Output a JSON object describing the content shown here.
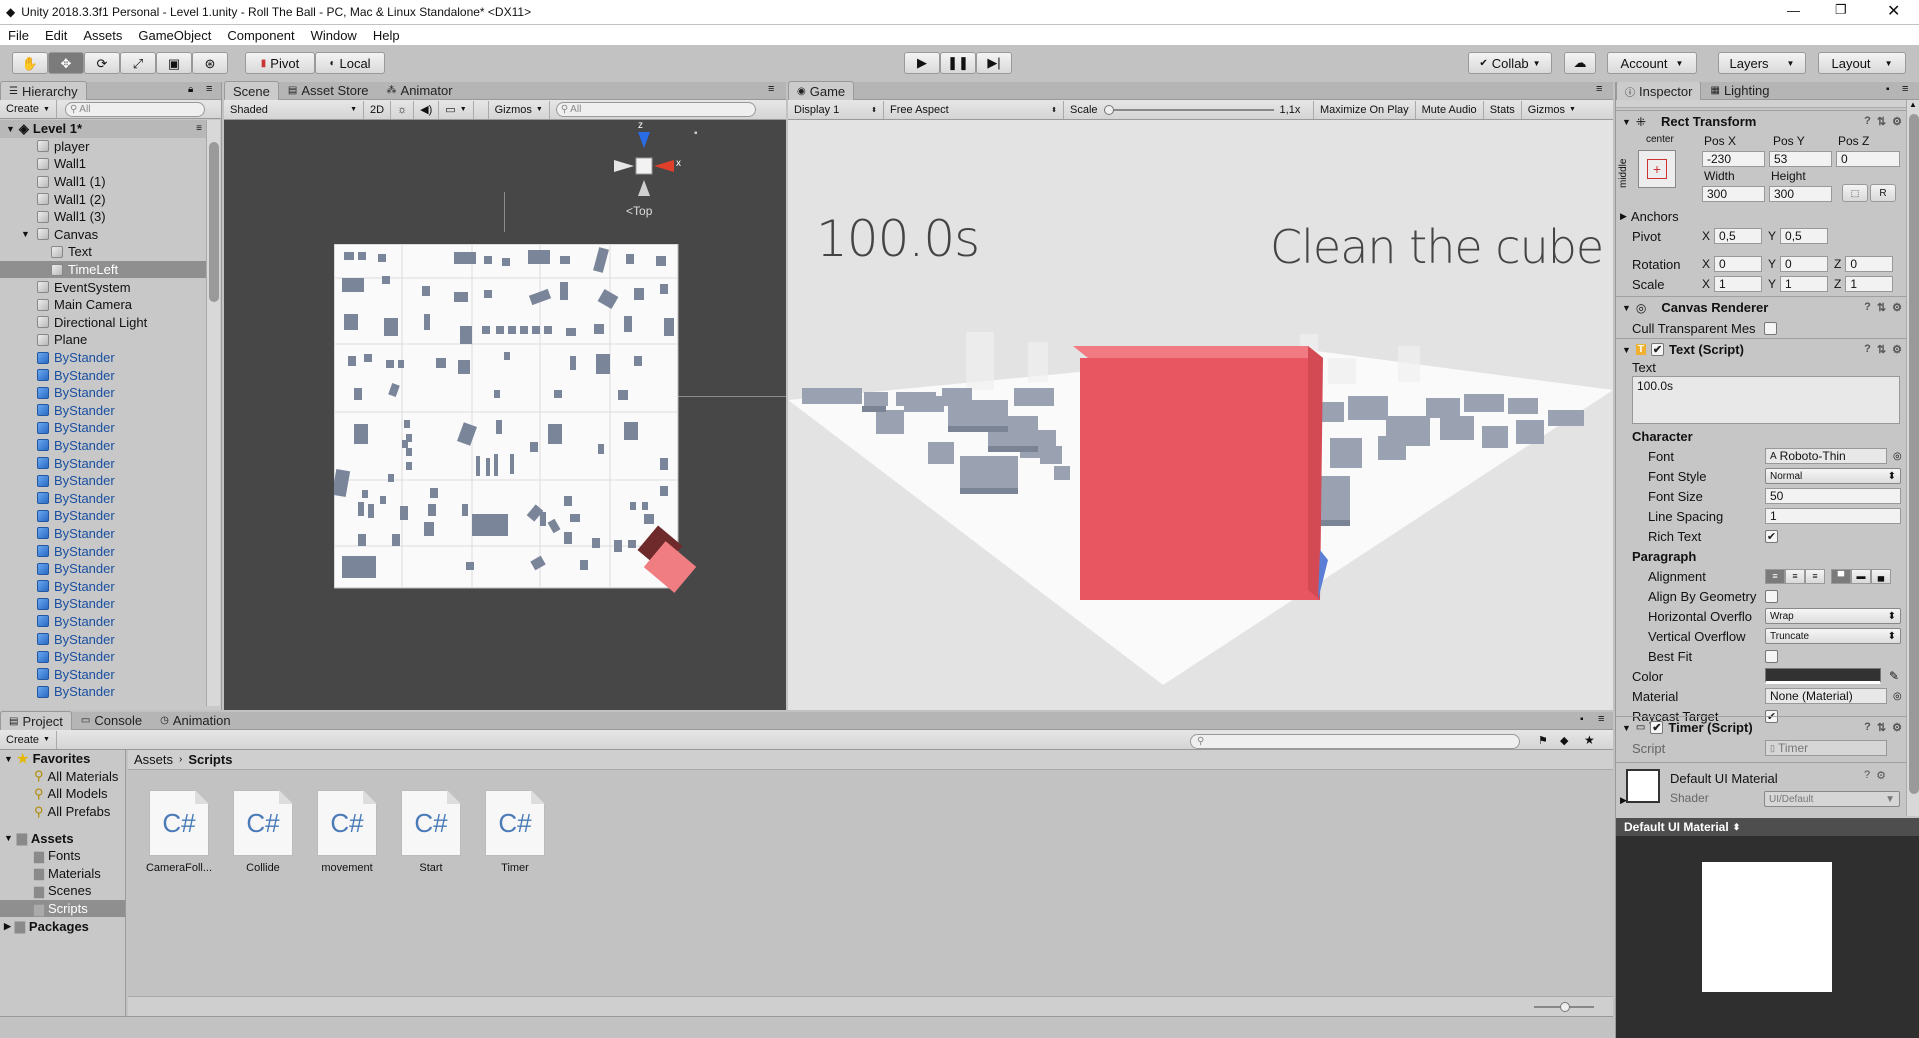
{
  "window": {
    "title": "Unity 2018.3.3f1 Personal - Level 1.unity - Roll The Ball - PC, Mac & Linux Standalone* <DX11>"
  },
  "menu": [
    "File",
    "Edit",
    "Assets",
    "GameObject",
    "Component",
    "Window",
    "Help"
  ],
  "toolbar": {
    "pivot": "Pivot",
    "local": "Local",
    "collab": "Collab",
    "account": "Account",
    "layers": "Layers",
    "layout": "Layout"
  },
  "hierarchy": {
    "tab": "Hierarchy",
    "create": "Create",
    "search_placeholder": "All",
    "scene": "Level 1*",
    "items": [
      "player",
      "Wall1",
      "Wall1 (1)",
      "Wall1 (2)",
      "Wall1 (3)",
      "Canvas",
      "Text",
      "TimeLeft",
      "EventSystem",
      "Main Camera",
      "Directional Light",
      "Plane",
      "ByStander",
      "ByStander",
      "ByStander",
      "ByStander",
      "ByStander",
      "ByStander",
      "ByStander",
      "ByStander",
      "ByStander",
      "ByStander",
      "ByStander",
      "ByStander",
      "ByStander",
      "ByStander",
      "ByStander",
      "ByStander",
      "ByStander",
      "ByStander",
      "ByStander",
      "ByStander"
    ]
  },
  "scene": {
    "tabs": [
      "Scene",
      "Asset Store",
      "Animator"
    ],
    "shading": "Shaded",
    "mode2d": "2D",
    "gizmos": "Gizmos",
    "search_placeholder": "All",
    "view_label": "Top",
    "axis_z": "z",
    "axis_x": "x"
  },
  "game": {
    "tab": "Game",
    "display": "Display 1",
    "aspect": "Free Aspect",
    "scale_label": "Scale",
    "scale_value": "1,1x",
    "maximize": "Maximize On Play",
    "mute": "Mute Audio",
    "stats": "Stats",
    "gizmos": "Gizmos",
    "timer_text": "100.0s",
    "goal_text": "Clean the cube"
  },
  "inspector": {
    "tabs": [
      "Inspector",
      "Lighting"
    ],
    "rect_transform": {
      "title": "Rect Transform",
      "anchor_h": "center",
      "anchor_v": "middle",
      "posx_label": "Pos X",
      "posy_label": "Pos Y",
      "posz_label": "Pos Z",
      "posx": "-230",
      "posy": "53",
      "posz": "0",
      "width_label": "Width",
      "height_label": "Height",
      "width": "300",
      "height": "300",
      "anchors": "Anchors",
      "pivot": "Pivot",
      "pivot_x": "0,5",
      "pivot_y": "0,5",
      "rotation": "Rotation",
      "rot_x": "0",
      "rot_y": "0",
      "rot_z": "0",
      "scale": "Scale",
      "scale_x": "1",
      "scale_y": "1",
      "scale_z": "1",
      "r_btn": "R"
    },
    "canvas_renderer": {
      "title": "Canvas Renderer",
      "cull_label": "Cull Transparent Mes"
    },
    "text_script": {
      "title": "Text (Script)",
      "text_label": "Text",
      "text_value": "100.0s",
      "character": "Character",
      "font_label": "Font",
      "font": "Roboto-Thin",
      "font_style_label": "Font Style",
      "font_style": "Normal",
      "font_size_label": "Font Size",
      "font_size": "50",
      "line_spacing_label": "Line Spacing",
      "line_spacing": "1",
      "rich_text_label": "Rich Text",
      "paragraph": "Paragraph",
      "alignment_label": "Alignment",
      "align_geo_label": "Align By Geometry",
      "h_overflow_label": "Horizontal Overflo",
      "h_overflow": "Wrap",
      "v_overflow_label": "Vertical Overflow",
      "v_overflow": "Truncate",
      "best_fit_label": "Best Fit",
      "color_label": "Color",
      "material_label": "Material",
      "material": "None (Material)",
      "raycast_label": "Raycast Target"
    },
    "timer_script": {
      "title": "Timer (Script)",
      "script_label": "Script",
      "script": "Timer"
    },
    "material": {
      "title": "Default UI Material",
      "shader_label": "Shader",
      "shader": "UI/Default",
      "preview_title": "Default UI Material"
    }
  },
  "project": {
    "tabs": [
      "Project",
      "Console",
      "Animation"
    ],
    "create": "Create",
    "favorites": "Favorites",
    "fav_items": [
      "All Materials",
      "All Models",
      "All Prefabs"
    ],
    "assets": "Assets",
    "asset_folders": [
      "Fonts",
      "Materials",
      "Scenes",
      "Scripts"
    ],
    "packages": "Packages",
    "breadcrumb_root": "Assets",
    "breadcrumb_current": "Scripts",
    "files": [
      "CameraFoll...",
      "Collide",
      "movement",
      "Start",
      "Timer"
    ],
    "file_icon_text": "C#"
  },
  "colors": {
    "accent_red": "#ec5b64",
    "selection": "#8f8f8f"
  }
}
